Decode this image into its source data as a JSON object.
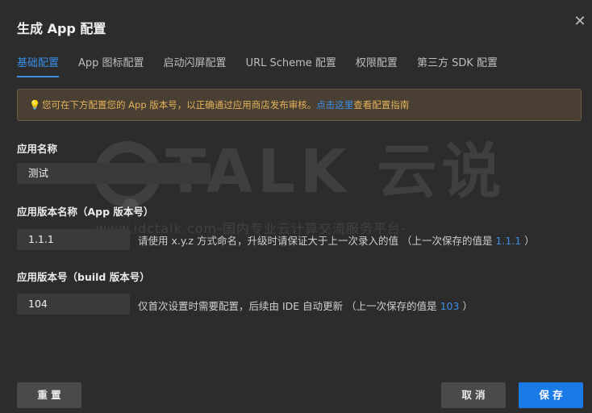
{
  "dialog": {
    "title": "生成 App 配置"
  },
  "tabs": [
    {
      "label": "基础配置"
    },
    {
      "label": "App 图标配置"
    },
    {
      "label": "启动闪屏配置"
    },
    {
      "label": "URL Scheme 配置"
    },
    {
      "label": "权限配置"
    },
    {
      "label": "第三方 SDK 配置"
    }
  ],
  "notice": {
    "text": "您可在下方配置您的 App 版本号，以正确通过应用商店发布审核。",
    "link": "点击这里",
    "suffix": "查看配置指南"
  },
  "form": {
    "app_name_label": "应用名称",
    "app_name_value": "测试",
    "version_name_label": "应用版本名称（App 版本号）",
    "version_name_value": "1.1.1",
    "version_name_hint": "请使用 x.y.z 方式命名，升级时请保证大于上一次录入的值 （上一次保存的值是 ",
    "version_name_last": "1.1.1",
    "version_name_hint_end": " ）",
    "version_code_label": "应用版本号（build 版本号）",
    "version_code_value": "104",
    "version_code_hint": "仅首次设置时需要配置，后续由 IDE 自动更新 （上一次保存的值是 ",
    "version_code_last": "103",
    "version_code_hint_end": " ）"
  },
  "watermark": {
    "brand": "TALK 云说",
    "line": "-www.idctalk.com-国内专业云计算交流服务平台-"
  },
  "buttons": {
    "reset": "重 置",
    "cancel": "取 消",
    "save": "保 存"
  },
  "icons": {
    "close": "close-icon",
    "notice": "lightbulb-icon"
  }
}
